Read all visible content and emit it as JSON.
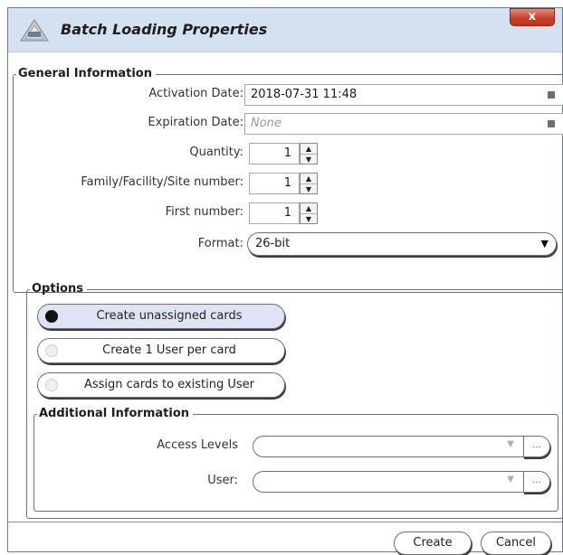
{
  "window": {
    "title": "Batch Loading Properties",
    "close_label": "x"
  },
  "general": {
    "legend": "General Information",
    "activation_date": {
      "label": "Activation Date:",
      "value": "2018-07-31 11:48"
    },
    "expiration_date": {
      "label": "Expiration Date:",
      "placeholder": "None"
    },
    "quantity": {
      "label": "Quantity:",
      "value": "1"
    },
    "family_site": {
      "label": "Family/Facility/Site number:",
      "value": "1"
    },
    "first_number": {
      "label": "First number:",
      "value": "1"
    },
    "format": {
      "label": "Format:",
      "value": "26-bit"
    }
  },
  "options": {
    "legend": "Options",
    "choices": [
      {
        "label": "Create unassigned cards",
        "selected": true
      },
      {
        "label": "Create 1 User per card",
        "selected": false
      },
      {
        "label": "Assign cards to existing User",
        "selected": false
      }
    ]
  },
  "additional": {
    "legend": "Additional Information",
    "access_levels": {
      "label": "Access Levels",
      "ellipsis": "..."
    },
    "user": {
      "label": "User:",
      "ellipsis": "..."
    }
  },
  "buttons": {
    "create": "Create",
    "cancel": "Cancel"
  },
  "icons": {
    "spin_up": "▲",
    "spin_down": "▼",
    "dropdown": "▼"
  }
}
